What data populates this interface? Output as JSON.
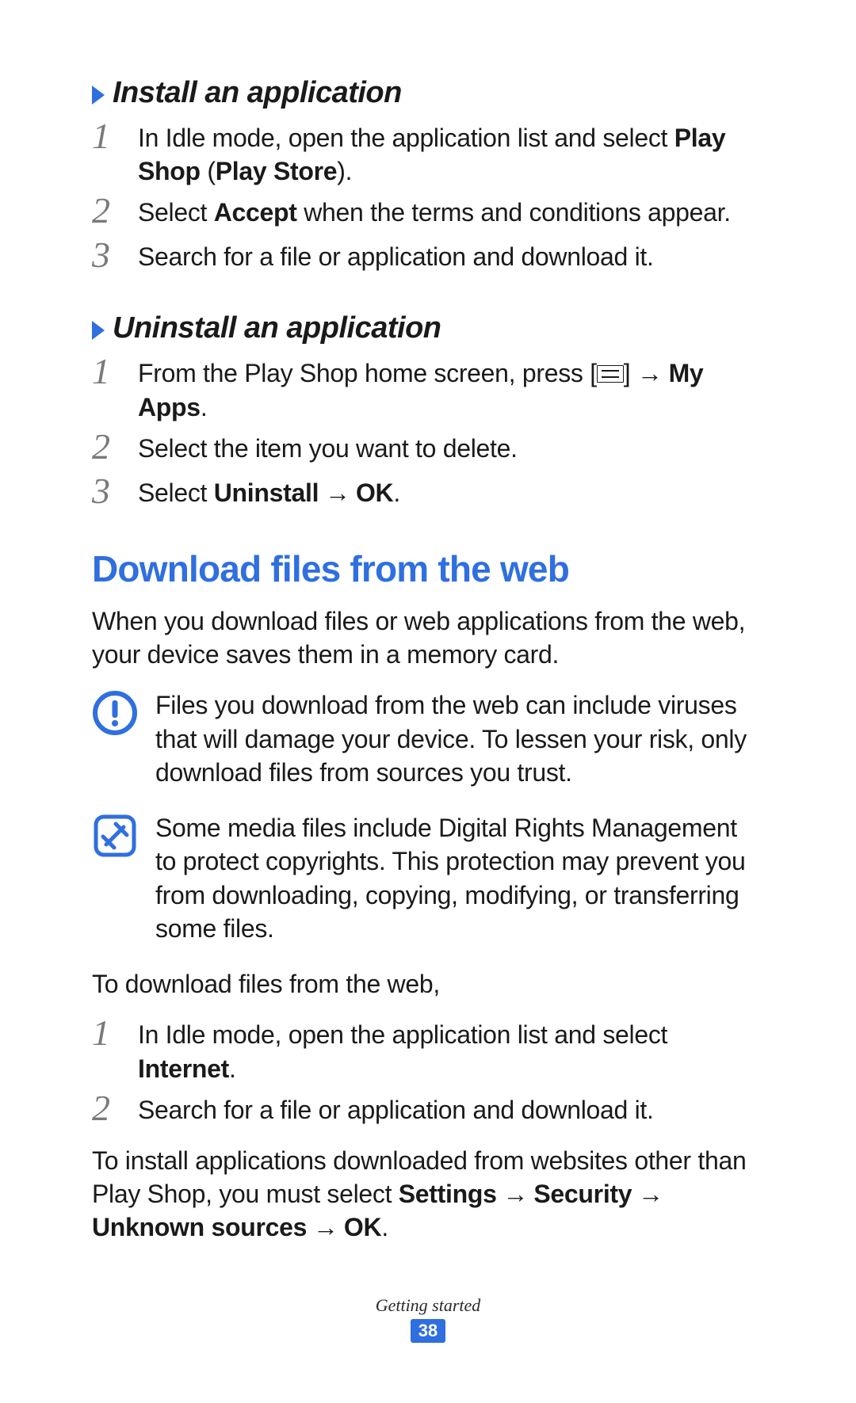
{
  "sections": {
    "install": {
      "heading": "Install an application",
      "steps": [
        {
          "num": "1",
          "pre": "In Idle mode, open the application list and select ",
          "b1": "Play Shop",
          "mid": " (",
          "b2": "Play Store",
          "post": ")."
        },
        {
          "num": "2",
          "pre": "Select ",
          "b1": "Accept",
          "mid": " when the terms and conditions appear.",
          "b2": "",
          "post": ""
        },
        {
          "num": "3",
          "pre": "Search for a file or application and download it.",
          "b1": "",
          "mid": "",
          "b2": "",
          "post": ""
        }
      ]
    },
    "uninstall": {
      "heading": "Uninstall an application",
      "steps": [
        {
          "num": "1",
          "pre": "From the Play Shop home screen, press [",
          "icon": true,
          "mid": "] ",
          "arrow": "→",
          "b1": " My Apps",
          "post": "."
        },
        {
          "num": "2",
          "pre": "Select the item you want to delete."
        },
        {
          "num": "3",
          "pre": "Select ",
          "b1": "Uninstall",
          "arrow": " → ",
          "b2": "OK",
          "post": "."
        }
      ]
    },
    "download": {
      "title": "Download files from the web",
      "intro": "When you download files or web applications from the web, your device saves them in a memory card.",
      "warning": "Files you download from the web can include viruses that will damage your device. To lessen your risk, only download files from sources you trust.",
      "note": "Some media files include Digital Rights Management to protect copyrights. This protection may prevent you from downloading, copying, modifying, or transferring some files.",
      "lead": "To download files from the web,",
      "steps": [
        {
          "num": "1",
          "pre": "In Idle mode, open the application list and select ",
          "b1": "Internet",
          "post": "."
        },
        {
          "num": "2",
          "pre": "Search for a file or application and download it."
        }
      ],
      "tail_pre": "To install applications downloaded from websites other than Play Shop, you must select ",
      "tail_b1": "Settings",
      "tail_a1": " → ",
      "tail_b2": "Security",
      "tail_a2": " → ",
      "tail_b3": "Unknown sources",
      "tail_a3": " → ",
      "tail_b4": "OK",
      "tail_post": "."
    }
  },
  "footer": {
    "section": "Getting started",
    "page": "38"
  }
}
